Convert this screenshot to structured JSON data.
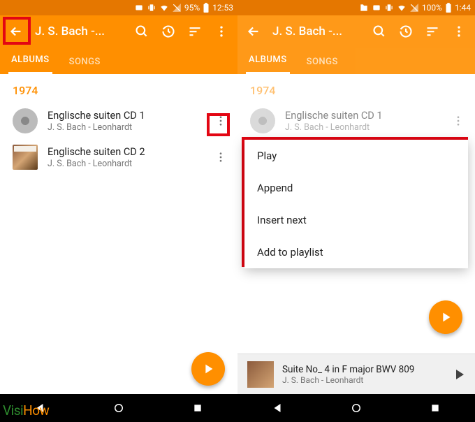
{
  "left": {
    "status": {
      "battery": "95%",
      "time": "12:53"
    },
    "title": "J. S. Bach -...",
    "tabs": {
      "albums": "ALBUMS",
      "songs": "SONGS"
    },
    "year": "1974",
    "items": [
      {
        "title": "Englische suiten CD 1",
        "subtitle": "J. S. Bach - Leonhardt"
      },
      {
        "title": "Englische suiten CD 2",
        "subtitle": "J. S. Bach - Leonhardt"
      }
    ]
  },
  "right": {
    "status": {
      "battery": "100%",
      "time": "1:44"
    },
    "title": "J. S. Bach -...",
    "tabs": {
      "albums": "ALBUMS",
      "songs": "SONGS"
    },
    "year": "1974",
    "items": [
      {
        "title": "Englische suiten CD 1",
        "subtitle": "J. S. Bach - Leonhardt"
      }
    ],
    "menu": [
      "Play",
      "Append",
      "Insert next",
      "Add to playlist"
    ],
    "nowplaying": {
      "title": "Suite No_ 4 in F major BWV 809",
      "subtitle": "J. S. Bach - Leonhardt"
    }
  },
  "logo": {
    "part1": "Visi",
    "part2": "How"
  }
}
